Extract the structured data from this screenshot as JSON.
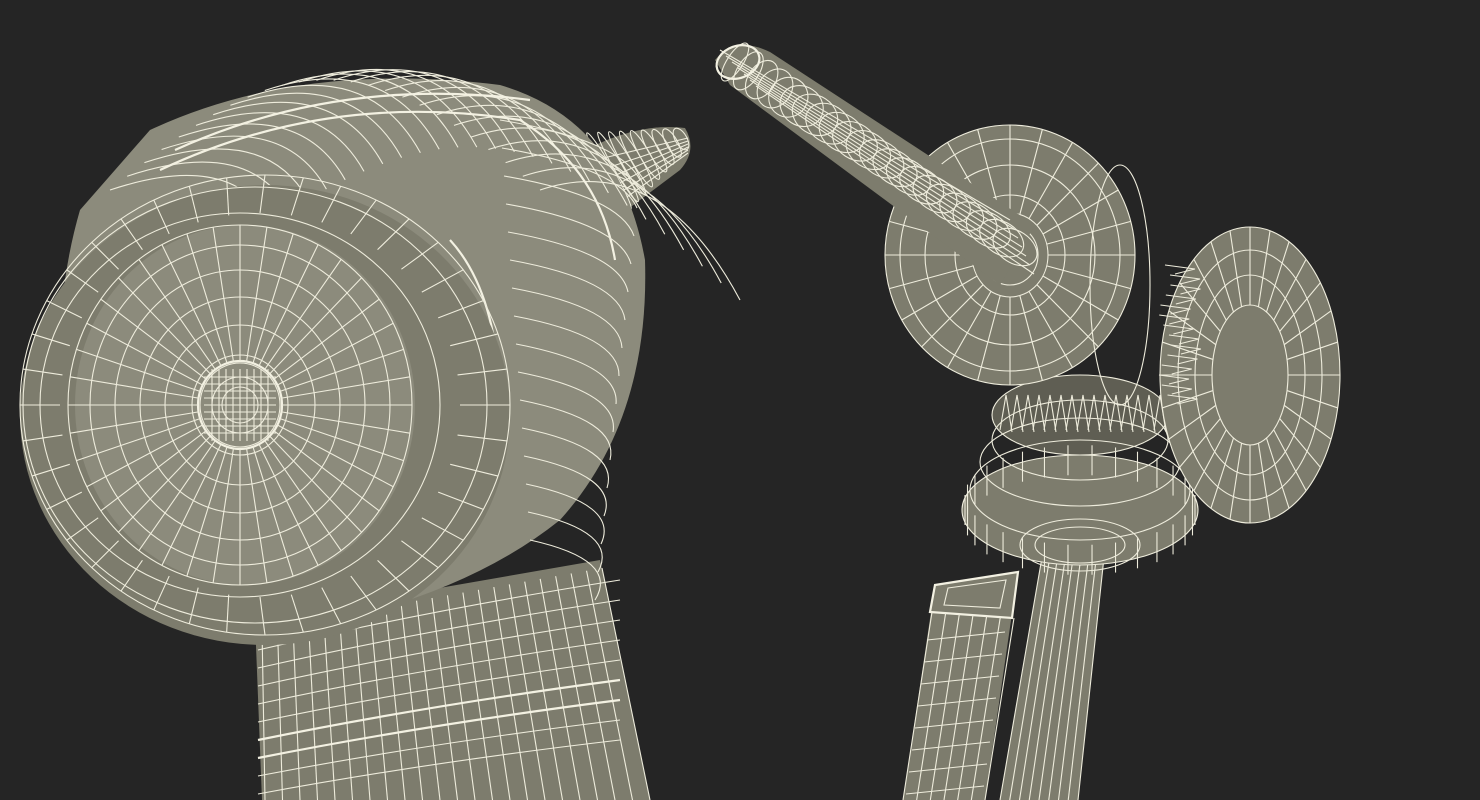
{
  "scene": {
    "background": "#252525",
    "mesh_color": "#7d7c6d",
    "wire_color": "#eeecdc",
    "objects": [
      {
        "name": "dental-handpiece-head-closeup"
      },
      {
        "name": "dental-handpiece-exploded-parts"
      }
    ]
  }
}
